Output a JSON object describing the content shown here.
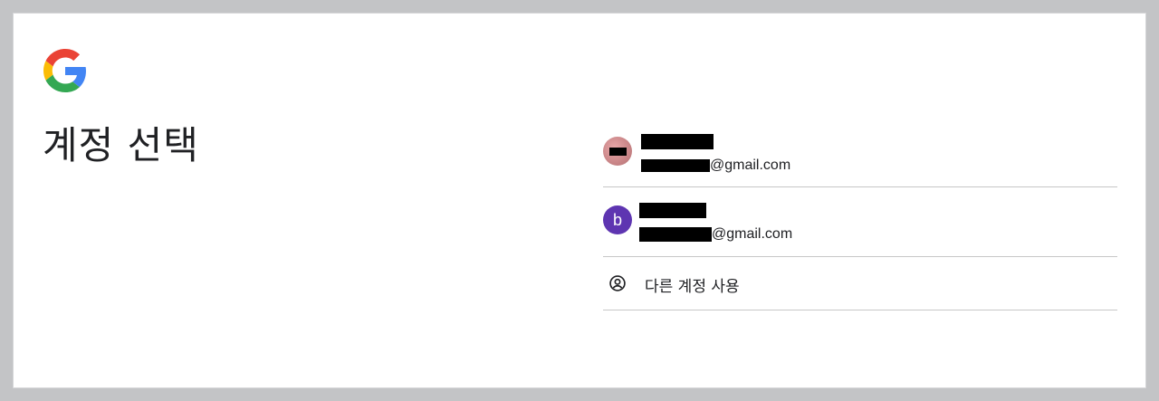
{
  "page": {
    "title": "계정 선택",
    "logo_icon": "google-g-logo"
  },
  "accounts": [
    {
      "name": "",
      "email_suffix": "@gmail.com",
      "avatar_type": "photo",
      "avatar_letter": ""
    },
    {
      "name": "",
      "email_suffix": "@gmail.com",
      "avatar_type": "letter",
      "avatar_letter": "b",
      "avatar_color": "#5e35b1"
    }
  ],
  "other_account": {
    "label": "다른 계정 사용",
    "icon": "account-circle-icon"
  },
  "colors": {
    "background": "#c3c4c6",
    "card": "#ffffff",
    "divider": "#c7c7c7",
    "text": "#202124"
  }
}
